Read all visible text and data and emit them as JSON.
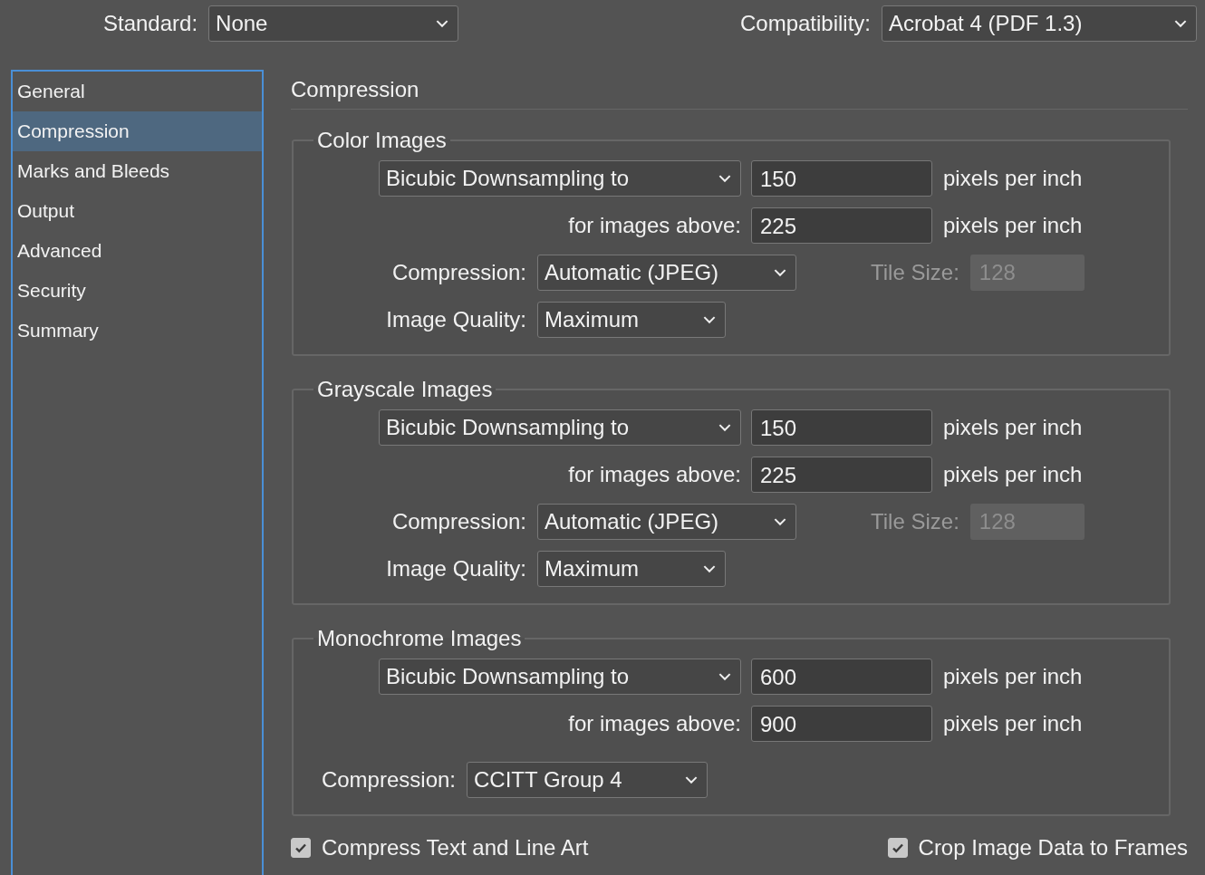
{
  "standard": {
    "label": "Standard:",
    "value": "None"
  },
  "compatibility": {
    "label": "Compatibility:",
    "value": "Acrobat 4 (PDF 1.3)"
  },
  "sidebar": {
    "items": [
      {
        "label": "General",
        "selected": false
      },
      {
        "label": "Compression",
        "selected": true
      },
      {
        "label": "Marks and Bleeds",
        "selected": false
      },
      {
        "label": "Output",
        "selected": false
      },
      {
        "label": "Advanced",
        "selected": false
      },
      {
        "label": "Security",
        "selected": false
      },
      {
        "label": "Summary",
        "selected": false
      }
    ]
  },
  "panel": {
    "title": "Compression",
    "groups": [
      {
        "kind": "full",
        "title": "Color Images",
        "downsampling": "Bicubic Downsampling to",
        "resolution": "150",
        "unit": "pixels per inch",
        "above_label": "for images above:",
        "above": "225",
        "above_unit": "pixels per inch",
        "compression_label": "Compression:",
        "compression": "Automatic (JPEG)",
        "tile_label": "Tile Size:",
        "tile": "128",
        "tile_disabled": true,
        "quality_label": "Image Quality:",
        "quality": "Maximum"
      },
      {
        "kind": "full",
        "title": "Grayscale Images",
        "downsampling": "Bicubic Downsampling to",
        "resolution": "150",
        "unit": "pixels per inch",
        "above_label": "for images above:",
        "above": "225",
        "above_unit": "pixels per inch",
        "compression_label": "Compression:",
        "compression": "Automatic (JPEG)",
        "tile_label": "Tile Size:",
        "tile": "128",
        "tile_disabled": true,
        "quality_label": "Image Quality:",
        "quality": "Maximum"
      },
      {
        "kind": "mono",
        "title": "Monochrome Images",
        "downsampling": "Bicubic Downsampling to",
        "resolution": "600",
        "unit": "pixels per inch",
        "above_label": "for images above:",
        "above": "900",
        "above_unit": "pixels per inch",
        "compression_label": "Compression:",
        "compression": "CCITT Group 4"
      }
    ],
    "checkboxes": [
      {
        "label": "Compress Text and Line Art",
        "checked": true
      },
      {
        "label": "Crop Image Data to Frames",
        "checked": true
      }
    ]
  }
}
